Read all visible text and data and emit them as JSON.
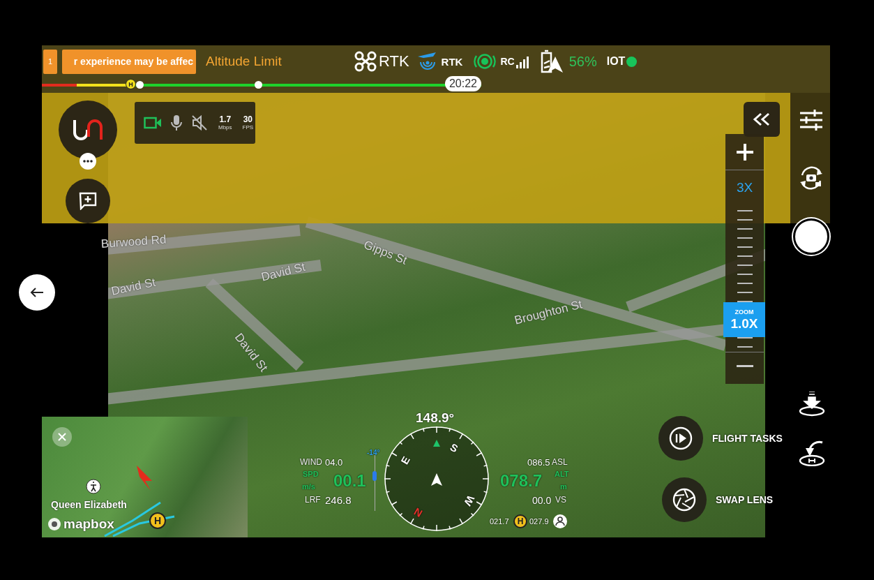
{
  "status_bar": {
    "warning_count": "1",
    "warning_text": "r experience may be affec",
    "alert": "Altitude Limit",
    "aircraft_rtk": "RTK",
    "rc_rtk": "RTK",
    "rc_label": "RC",
    "battery": "56%",
    "iot": "IOT",
    "iot_online": true
  },
  "timeline": {
    "segments": [
      {
        "color": "#e32b1e",
        "level": 0.08
      },
      {
        "color": "#f2e01c",
        "level": 0.12
      },
      {
        "color": "#1fd12b",
        "level": 0.8
      }
    ],
    "markers": [
      {
        "kind": "home",
        "label": "H",
        "level": 0.203
      },
      {
        "kind": "waypoint",
        "level": 0.222
      },
      {
        "kind": "waypoint",
        "level": 0.492
      }
    ],
    "time": "20:22"
  },
  "stream": {
    "camera_on": true,
    "sound_muted": true,
    "bitrate": "1.7",
    "bitrate_unit": "Mbps",
    "fps": "30",
    "fps_unit": "FPS"
  },
  "zoom": {
    "max": "3X",
    "label": "ZOOM",
    "value": "1.0X",
    "level": 0.2
  },
  "ar_labels": [
    "Burwood Rd",
    "Gipps St",
    "David St",
    "David St",
    "David St",
    "Broughton St"
  ],
  "telemetry": {
    "heading": "148.9°",
    "compass": [
      "E",
      "S",
      "W",
      "N"
    ],
    "wind_label": "WIND",
    "wind": "04.0",
    "speed_label": "SPD",
    "speed_unit": "m/s",
    "speed": "00.1",
    "lrf_label": "LRF",
    "lrf": "246.8",
    "gimbal_pitch": "-14°",
    "asl": "086.5",
    "asl_label": "ASL",
    "altitude": "078.7",
    "alt_label": "ALT",
    "alt_unit": "m",
    "vs": "00.0",
    "vs_label": "VS",
    "home_distance": "021.7",
    "home_label": "H",
    "pilot_distance": "027.9"
  },
  "actions": [
    {
      "kind": "flight_tasks",
      "label": "FLIGHT TASKS"
    },
    {
      "kind": "swap_lens",
      "label": "SWAP LENS"
    }
  ],
  "minimap": {
    "place": "Queen Elizabeth",
    "attribution": "mapbox",
    "home_label": "H"
  }
}
